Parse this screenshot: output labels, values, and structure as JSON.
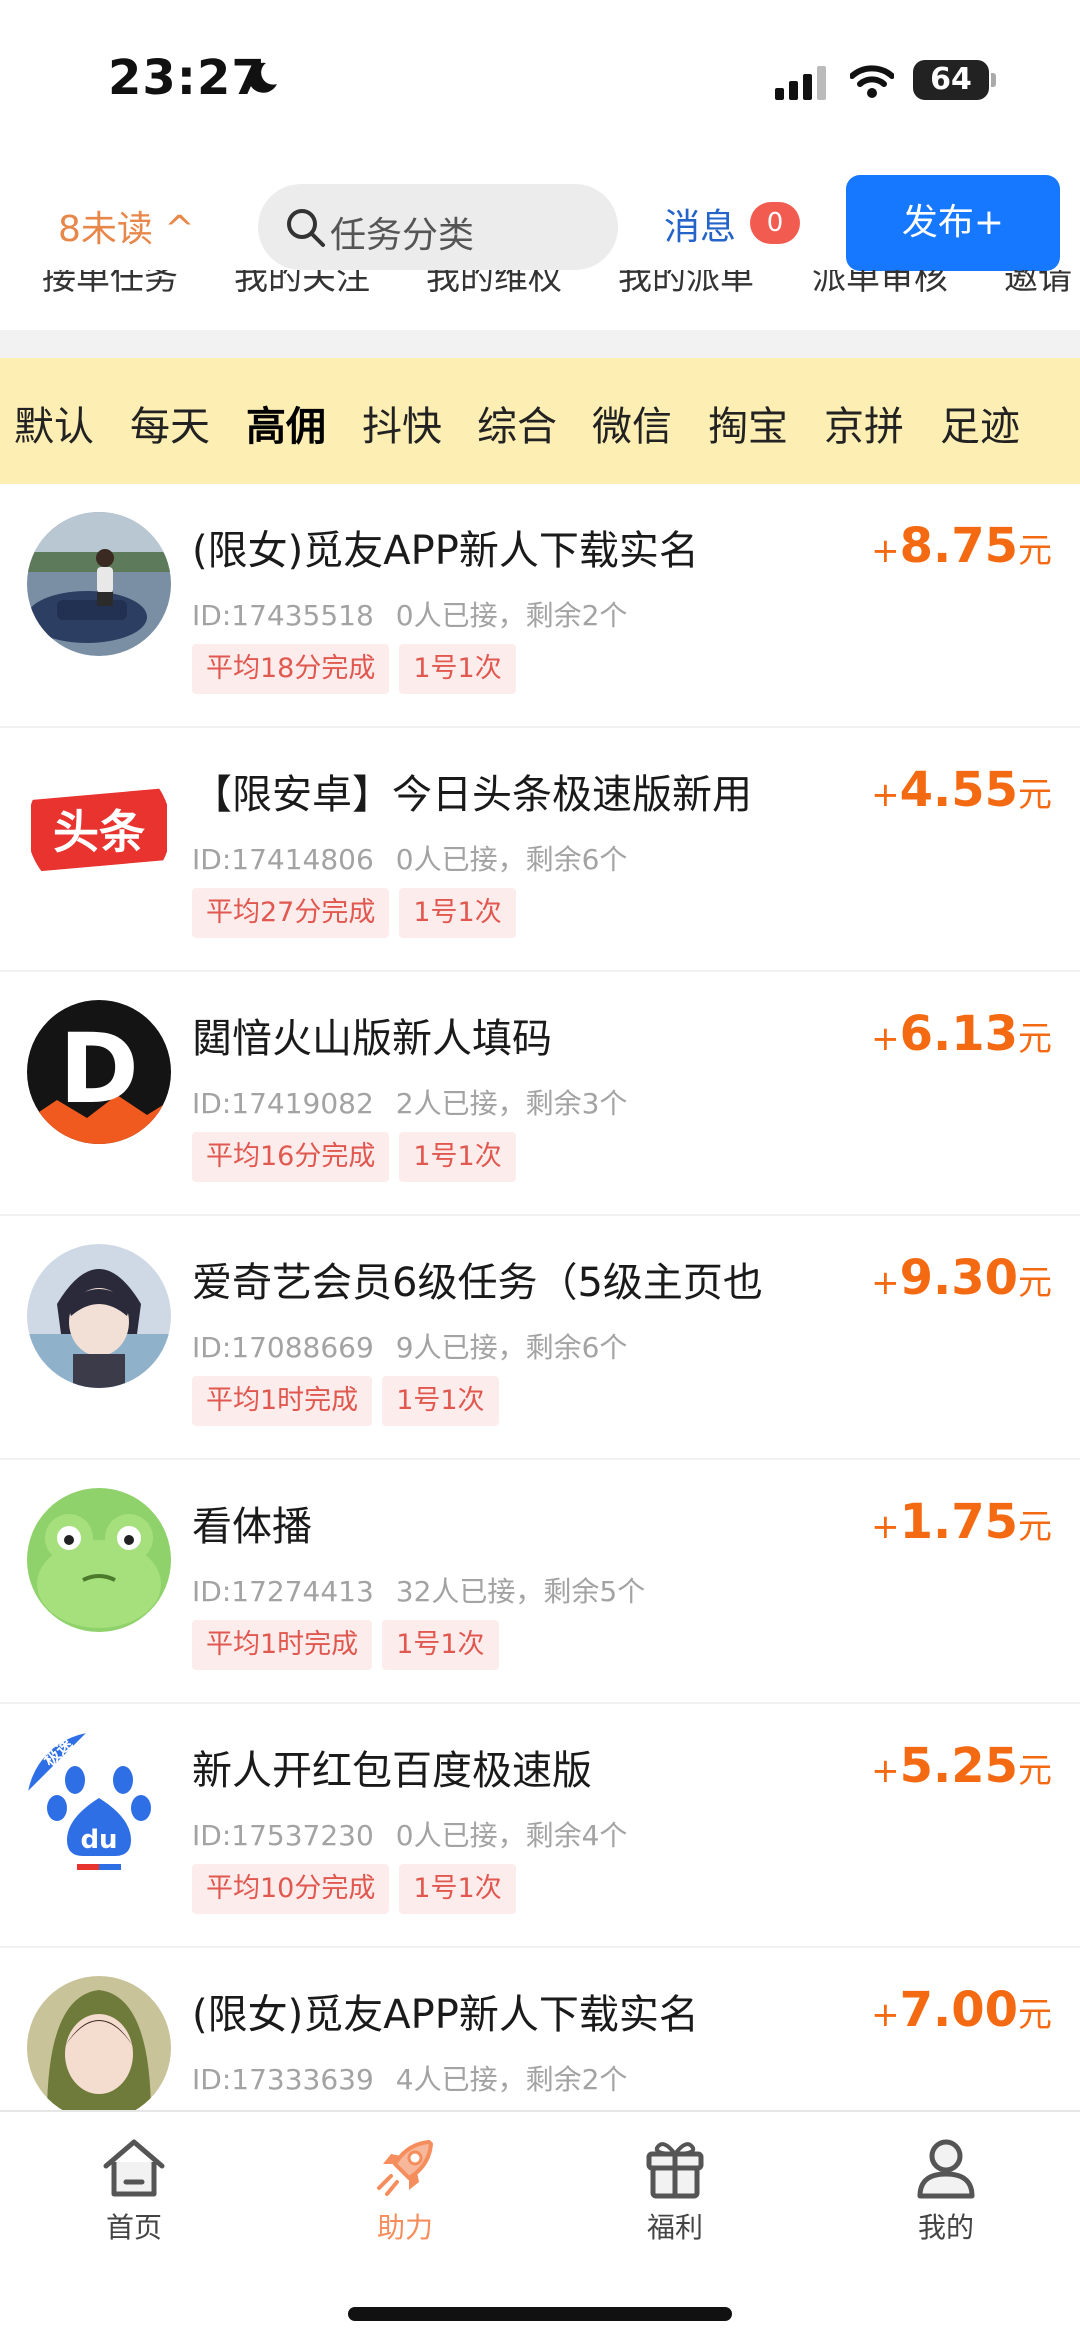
{
  "status": {
    "time": "23:27",
    "battery": "64"
  },
  "header": {
    "unread": "8未读 ^",
    "search_placeholder": "任务分类",
    "messages_label": "消息",
    "messages_count": "0",
    "publish_label": "发布+"
  },
  "quick_tabs": [
    "接单任务",
    "我的关注",
    "我的维权",
    "我的派单",
    "派单审核",
    "邀请"
  ],
  "filters": [
    "默认",
    "每天",
    "高佣",
    "抖快",
    "综合",
    "微信",
    "掏宝",
    "京拼",
    "足迹"
  ],
  "active_filter": "高佣",
  "tasks": [
    {
      "title": "(限女)觅友APP新人下载实名",
      "id": "ID:17435518",
      "accepted": "0人已接，剩余2个",
      "avg": "平均18分完成",
      "limit": "1号1次",
      "plus": "+",
      "amount": "8.75",
      "unit": "元",
      "avatar": "person-car"
    },
    {
      "title": "【限安卓】今日头条极速版新用",
      "id": "ID:17414806",
      "accepted": "0人已接，剩余6个",
      "avg": "平均27分完成",
      "limit": "1号1次",
      "plus": "+",
      "amount": "4.55",
      "unit": "元",
      "avatar": "toutiao-logo",
      "logo_text": "头条"
    },
    {
      "title": "閮愔火山版新人填码",
      "id": "ID:17419082",
      "accepted": "2人已接，剩余3个",
      "avg": "平均16分完成",
      "limit": "1号1次",
      "plus": "+",
      "amount": "6.13",
      "unit": "元",
      "avatar": "d-logo",
      "logo_text": "D"
    },
    {
      "title": "爱奇艺会员6级任务（5级主页也",
      "id": "ID:17088669",
      "accepted": "9人已接，剩余6个",
      "avg": "平均1时完成",
      "limit": "1号1次",
      "plus": "+",
      "amount": "9.30",
      "unit": "元",
      "avatar": "anime-boy"
    },
    {
      "title": "看体播",
      "id": "ID:17274413",
      "accepted": "32人已接，剩余5个",
      "avg": "平均1时完成",
      "limit": "1号1次",
      "plus": "+",
      "amount": "1.75",
      "unit": "元",
      "avatar": "frog"
    },
    {
      "title": "新人开红包百度极速版",
      "id": "ID:17537230",
      "accepted": "0人已接，剩余4个",
      "avg": "平均10分完成",
      "limit": "1号1次",
      "plus": "+",
      "amount": "5.25",
      "unit": "元",
      "avatar": "baidu-logo",
      "logo_text": "du",
      "badge_text": "极速"
    },
    {
      "title": "(限女)觅友APP新人下载实名",
      "id": "ID:17333639",
      "accepted": "4人已接，剩余2个",
      "avg": "",
      "limit": "",
      "plus": "+",
      "amount": "7.00",
      "unit": "元",
      "avatar": "girl-hood"
    }
  ],
  "nav": [
    {
      "label": "首页",
      "icon": "home-icon"
    },
    {
      "label": "助力",
      "icon": "rocket-icon"
    },
    {
      "label": "福利",
      "icon": "gift-icon"
    },
    {
      "label": "我的",
      "icon": "user-icon"
    }
  ],
  "colors": {
    "accent": "#1677ff",
    "price": "#f46a12",
    "filter_bg": "#fdeeb3",
    "tag_bg": "#fdecec",
    "tag_text": "#e0584f",
    "nav_active": "#f58d5c"
  }
}
